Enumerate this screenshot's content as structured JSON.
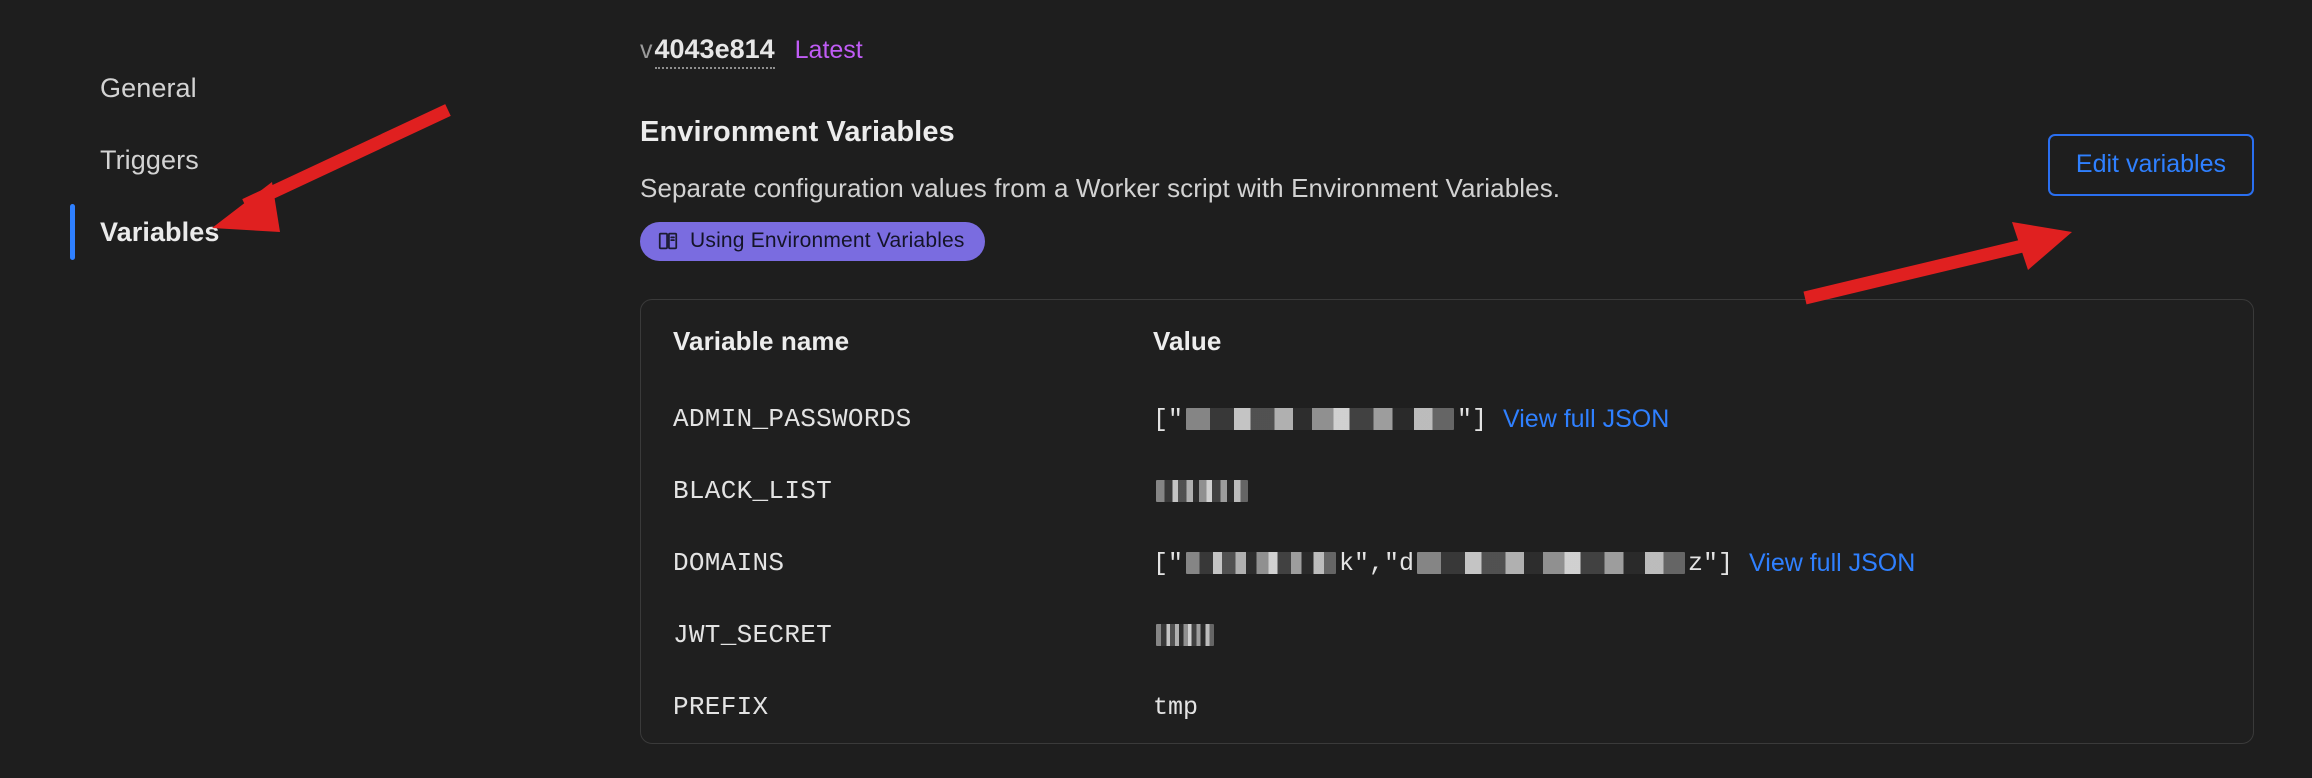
{
  "sidebar": {
    "items": [
      {
        "label": "General",
        "active": false
      },
      {
        "label": "Triggers",
        "active": false
      },
      {
        "label": "Variables",
        "active": true
      }
    ]
  },
  "version": {
    "prefix": "v",
    "hash": "4043e814",
    "tag": "Latest"
  },
  "section": {
    "title": "Environment Variables",
    "description": "Separate configuration values from a Worker script with Environment Variables.",
    "doc_badge": {
      "icon": "book-icon",
      "label": "Using Environment Variables"
    },
    "edit_button": "Edit variables"
  },
  "table": {
    "headers": [
      "Variable name",
      "Value"
    ],
    "rows": [
      {
        "name": "ADMIN_PASSWORDS",
        "value_prefix": "[\"",
        "value_redacted": "wide",
        "value_suffix": "\"]",
        "link": "View full JSON"
      },
      {
        "name": "BLACK_LIST",
        "value_prefix": "",
        "value_redacted": "small",
        "value_suffix": "",
        "link": ""
      },
      {
        "name": "DOMAINS",
        "value_prefix": "[\"",
        "value_redacted": "wide",
        "value_mid": "k\",\"d",
        "value_redacted2": "mid",
        "value_suffix": "z\"]",
        "link": "View full JSON"
      },
      {
        "name": "JWT_SECRET",
        "value_prefix": "",
        "value_redacted": "tiny",
        "value_suffix": "",
        "link": ""
      },
      {
        "name": "PREFIX",
        "value_plain": "tmp",
        "link": ""
      }
    ]
  },
  "annotations": {
    "arrow_color": "#e02020",
    "arrow_1_target": "sidebar-item-variables",
    "arrow_2_target": "edit-variables-button"
  },
  "colors": {
    "background": "#1e1e1e",
    "accent_blue": "#2f80ff",
    "badge_purple": "#7a6ce0",
    "latest_purple": "#c05cf5"
  }
}
